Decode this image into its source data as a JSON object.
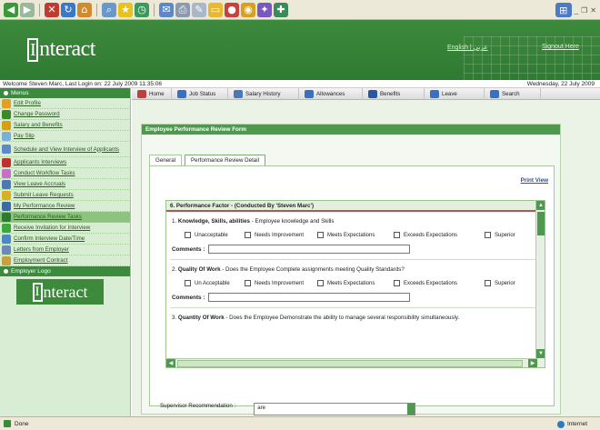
{
  "app": {
    "logo_text": "nteract",
    "logo_bracket": "I",
    "lang_link": "English | عربي",
    "signout": "Signout Here"
  },
  "welcome": {
    "text": "Welcome Steven Marc, Last Login on: 22 July 2009 11:35:06",
    "date": "Wednesday, 22 July 2009"
  },
  "menu": {
    "heading": "Menus",
    "items": [
      {
        "label": "Edit Profile",
        "icon": "pencil-icon",
        "color": "#e0a020"
      },
      {
        "label": "Change Password",
        "icon": "key-icon",
        "color": "#3a8a2a"
      },
      {
        "label": "Salary and Benefits",
        "icon": "money-icon",
        "color": "#d8a010"
      },
      {
        "label": "Pay Slip",
        "icon": "payslip-icon",
        "color": "#7ab0d8"
      },
      {
        "label": "Schedule and View Interview of Applicants",
        "icon": "schedule-icon",
        "color": "#5a8ac8",
        "multi": true
      },
      {
        "label": "Applicants Interviews",
        "icon": "interview-icon",
        "color": "#c03030"
      },
      {
        "label": "Conduct Workflow Tasks",
        "icon": "workflow-icon",
        "color": "#c870c8"
      },
      {
        "label": "View Leave Accruals",
        "icon": "leave-icon",
        "color": "#4a78b8"
      },
      {
        "label": "Submit Leave Requests",
        "icon": "request-icon",
        "color": "#d8b020"
      },
      {
        "label": "My Performance Review",
        "icon": "review-icon",
        "color": "#3a6aa8"
      },
      {
        "label": "Performance Review Tasks",
        "icon": "tasks-icon",
        "color": "#2f7a32",
        "active": true
      },
      {
        "label": "Receive Invitation for Interview",
        "icon": "invitation-icon",
        "color": "#3aa83a"
      },
      {
        "label": "Confirm Interview Date/Time",
        "icon": "calendar-icon",
        "color": "#4a88c8"
      },
      {
        "label": "Letters from Employer",
        "icon": "letter-icon",
        "color": "#6a88b8"
      },
      {
        "label": "Employment Contract",
        "icon": "contract-icon",
        "color": "#c8a040"
      }
    ],
    "employer_logo_heading": "Employer Logo",
    "employer_logo_text": "nteract"
  },
  "nav": {
    "items": [
      {
        "label": "Home",
        "icon": "home-icon",
        "color": "#c04040"
      },
      {
        "label": "Job Status",
        "icon": "job-status-icon",
        "color": "#3a70c0"
      },
      {
        "label": "Salary History",
        "icon": "salary-history-icon",
        "color": "#4a78b8"
      },
      {
        "label": "Allowances",
        "icon": "allowances-icon",
        "color": "#3a70c0"
      },
      {
        "label": "Benefits",
        "icon": "benefits-icon",
        "color": "#2a58a0"
      },
      {
        "label": "Leave",
        "icon": "leave-nav-icon",
        "color": "#3a70c0"
      },
      {
        "label": "Search",
        "icon": "search-icon",
        "color": "#3a70c0"
      }
    ]
  },
  "form": {
    "title": "Employee Performance Review Form",
    "tabs": [
      "General",
      "Performance Review Detail"
    ],
    "print_view": "Print View",
    "section_title": "6. Performance Factor - (Conducted By 'Steven Marc')",
    "questions": [
      {
        "num": "1.",
        "title": "Knowledge, Skills, abilities",
        "desc": " - Employee knowledge and Skills",
        "options": [
          "Unacceptable",
          "Needs Improvement",
          "Meets Expectations",
          "Exceeds Expectations",
          "Superior"
        ]
      },
      {
        "num": "2.",
        "title": "Quality Of Work",
        "desc": " - Does the Employee Complete assignments meeting Quality Standards?",
        "options": [
          "Un Acceptable",
          "Needs Improvement",
          "Meets Expectations",
          "Exceeds Expectations",
          "Superior"
        ]
      },
      {
        "num": "3.",
        "title": "Quantity Of Work",
        "desc": " - Does the Employee Demonstrate the ability to manage several responsibility simultaneously."
      }
    ],
    "comments_label": "Comments :",
    "supervisor_label": "Supervisor Recommendation :",
    "supervisor_value": "are"
  },
  "status": {
    "left": "Done",
    "zone": "Internet"
  }
}
